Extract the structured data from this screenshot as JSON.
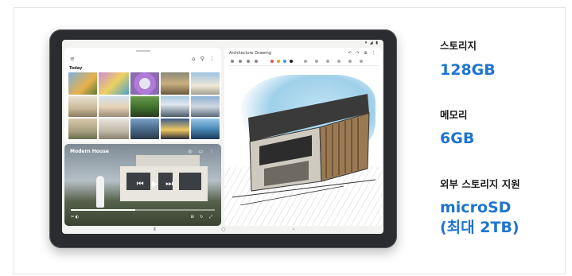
{
  "specs": [
    {
      "label": "스토리지",
      "value": "128GB"
    },
    {
      "label": "메모리",
      "value": "6GB"
    },
    {
      "label": "외부 스토리지 지원",
      "value_line1": "microSD",
      "value_line2": "(최대 2TB)"
    }
  ],
  "colors": {
    "accent": "#1f74d0",
    "label": "#1a1a1a",
    "border": "#e3e3e3"
  },
  "tablet_screen": {
    "gallery": {
      "section_label": "Today",
      "menu_icon": "menu-icon",
      "header_icons": [
        "cloud-icon",
        "search-icon",
        "more-icon"
      ]
    },
    "video": {
      "title": "Modern House",
      "progress": 0.45
    },
    "drawing": {
      "title": "Architecture Drawing"
    }
  }
}
